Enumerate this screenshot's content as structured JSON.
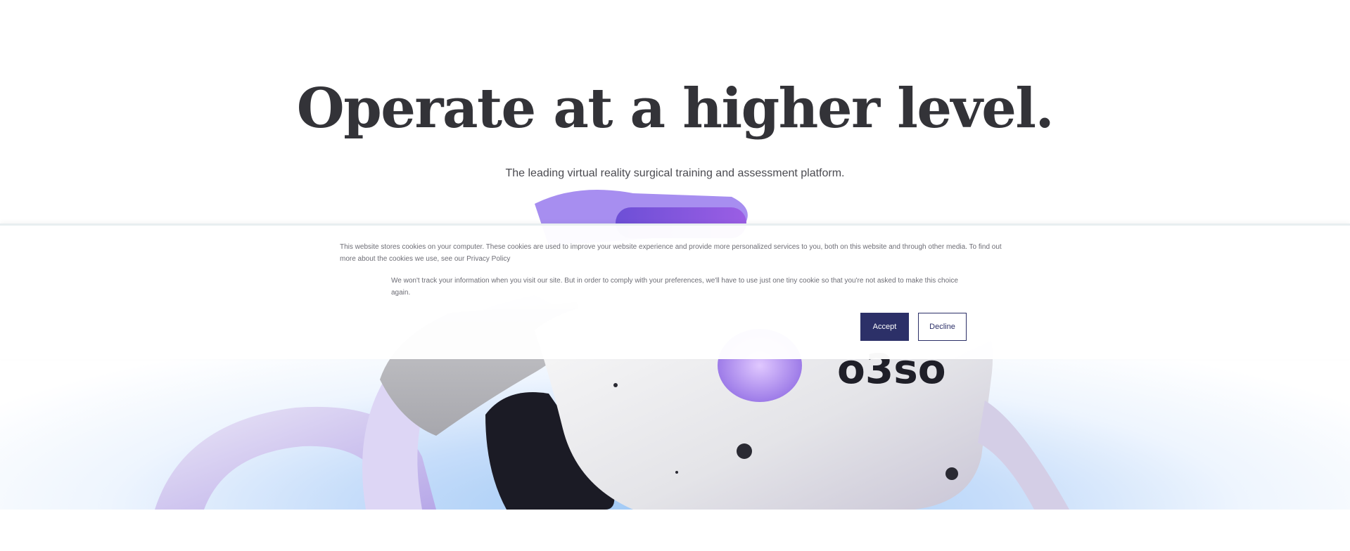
{
  "hero": {
    "title": "Operate at a higher level.",
    "subtitle": "The leading virtual reality surgical training and assessment platform.",
    "cta_label": "",
    "headset_logo_text": "o3so"
  },
  "cookie_banner": {
    "text_primary": "This website stores cookies on your computer. These cookies are used to improve your website experience and provide more personalized services to you, both on this website and through other media. To find out more about the cookies we use, see our Privacy Policy",
    "text_secondary": "We won't track your information when you visit our site. But in order to comply with your preferences, we'll have to use just one tiny cookie so that you're not asked to make this choice again.",
    "accept_label": "Accept",
    "decline_label": "Decline"
  },
  "colors": {
    "title": "#333338",
    "accept_bg": "#2c3068",
    "cta_gradient_start": "#6d4fd6",
    "cta_gradient_end": "#9b5ee4",
    "glow": "#9ec8f5"
  }
}
